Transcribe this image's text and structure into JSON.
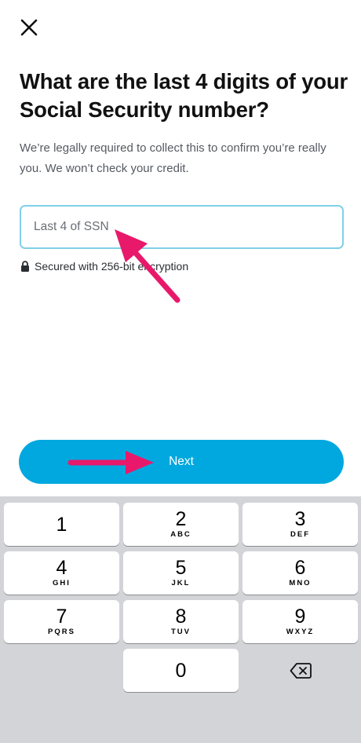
{
  "header": {
    "close_icon": "close-icon"
  },
  "main": {
    "title": "What are the last 4 digits of your Social Security number?",
    "subtitle": "We’re legally required to collect this to confirm you’re really you. We won’t check your credit.",
    "ssn_field": {
      "placeholder": "Last 4 of SSN",
      "value": ""
    },
    "secure_note": {
      "icon": "lock-icon",
      "text": "Secured with 256-bit encryption"
    },
    "next_label": "Next"
  },
  "colors": {
    "accent": "#00a8df",
    "field_border": "#7fd0e8",
    "annotation_arrow": "#e8196b",
    "keypad_bg": "#d2d4d8"
  },
  "keypad": {
    "keys": [
      {
        "num": "1",
        "letters": ""
      },
      {
        "num": "2",
        "letters": "ABC"
      },
      {
        "num": "3",
        "letters": "DEF"
      },
      {
        "num": "4",
        "letters": "GHI"
      },
      {
        "num": "5",
        "letters": "JKL"
      },
      {
        "num": "6",
        "letters": "MNO"
      },
      {
        "num": "7",
        "letters": "PQRS"
      },
      {
        "num": "8",
        "letters": "TUV"
      },
      {
        "num": "9",
        "letters": "WXYZ"
      },
      {
        "num": "0",
        "letters": ""
      }
    ],
    "delete_icon": "backspace-icon"
  }
}
